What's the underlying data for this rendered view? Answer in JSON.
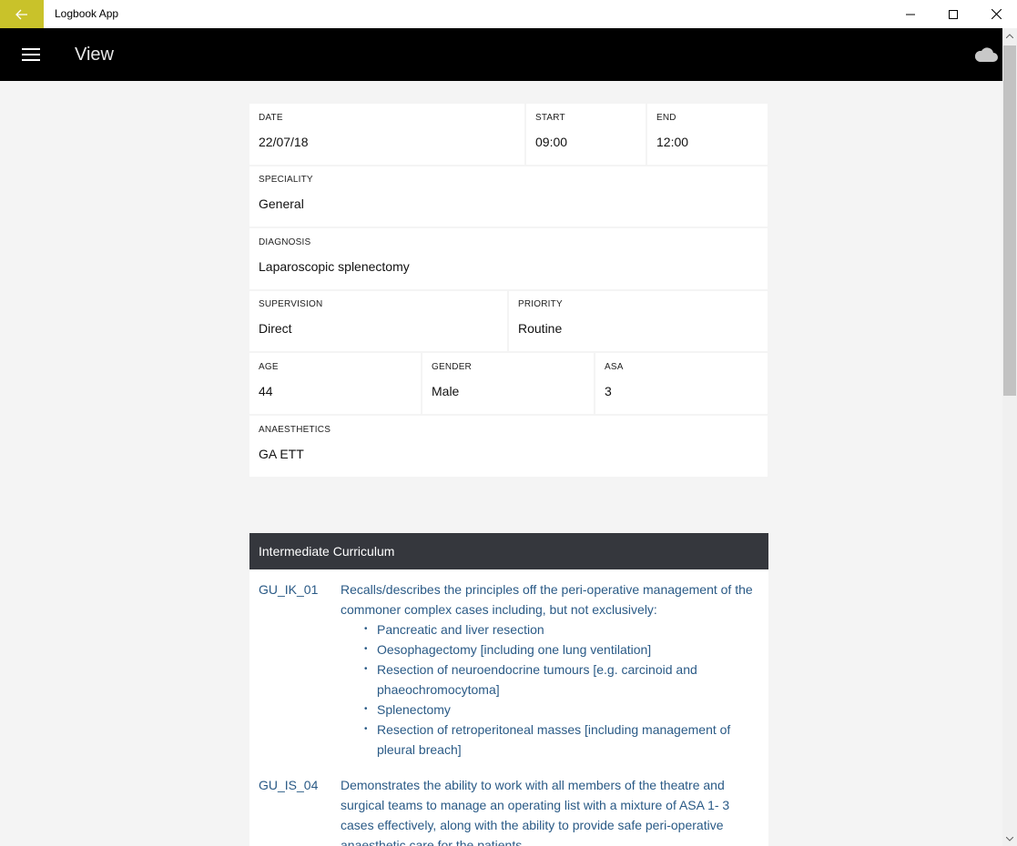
{
  "window": {
    "title": "Logbook App"
  },
  "appbar": {
    "title": "View"
  },
  "form": {
    "date": {
      "label": "DATE",
      "value": "22/07/18"
    },
    "start": {
      "label": "START",
      "value": "09:00"
    },
    "end": {
      "label": "END",
      "value": "12:00"
    },
    "speciality": {
      "label": "SPECIALITY",
      "value": "General"
    },
    "diagnosis": {
      "label": "DIAGNOSIS",
      "value": "Laparoscopic splenectomy"
    },
    "supervision": {
      "label": "SUPERVISION",
      "value": "Direct"
    },
    "priority": {
      "label": "PRIORITY",
      "value": "Routine"
    },
    "age": {
      "label": "AGE",
      "value": "44"
    },
    "gender": {
      "label": "GENDER",
      "value": "Male"
    },
    "asa": {
      "label": "ASA",
      "value": "3"
    },
    "anaesthetics": {
      "label": "ANAESTHETICS",
      "value": "GA ETT"
    }
  },
  "curriculum": {
    "title": "Intermediate Curriculum",
    "items": [
      {
        "code": "GU_IK_01",
        "text": "Recalls/describes the principles off the peri-operative management of the commoner complex cases including, but not exclusively:",
        "bullets": [
          "Pancreatic and liver resection",
          "Oesophagectomy [including one lung ventilation]",
          "Resection of neuroendocrine tumours [e.g. carcinoid and phaeochromocytoma]",
          "Splenectomy",
          "Resection of retroperitoneal masses [including management of pleural breach]"
        ]
      },
      {
        "code": "GU_IS_04",
        "text": "Demonstrates the ability to work with all members of the theatre and surgical teams to manage an operating list with a mixture of ASA 1- 3 cases effectively, along with the ability to provide safe peri-operative anaesthetic care for the patients"
      }
    ]
  },
  "colors": {
    "accent": "#c9c22a",
    "appbar": "#000000",
    "header": "#35373d",
    "link": "#2a5a86"
  },
  "icons": [
    "back-arrow-icon",
    "minimize-icon",
    "maximize-icon",
    "close-icon",
    "hamburger-icon",
    "cloud-icon"
  ]
}
